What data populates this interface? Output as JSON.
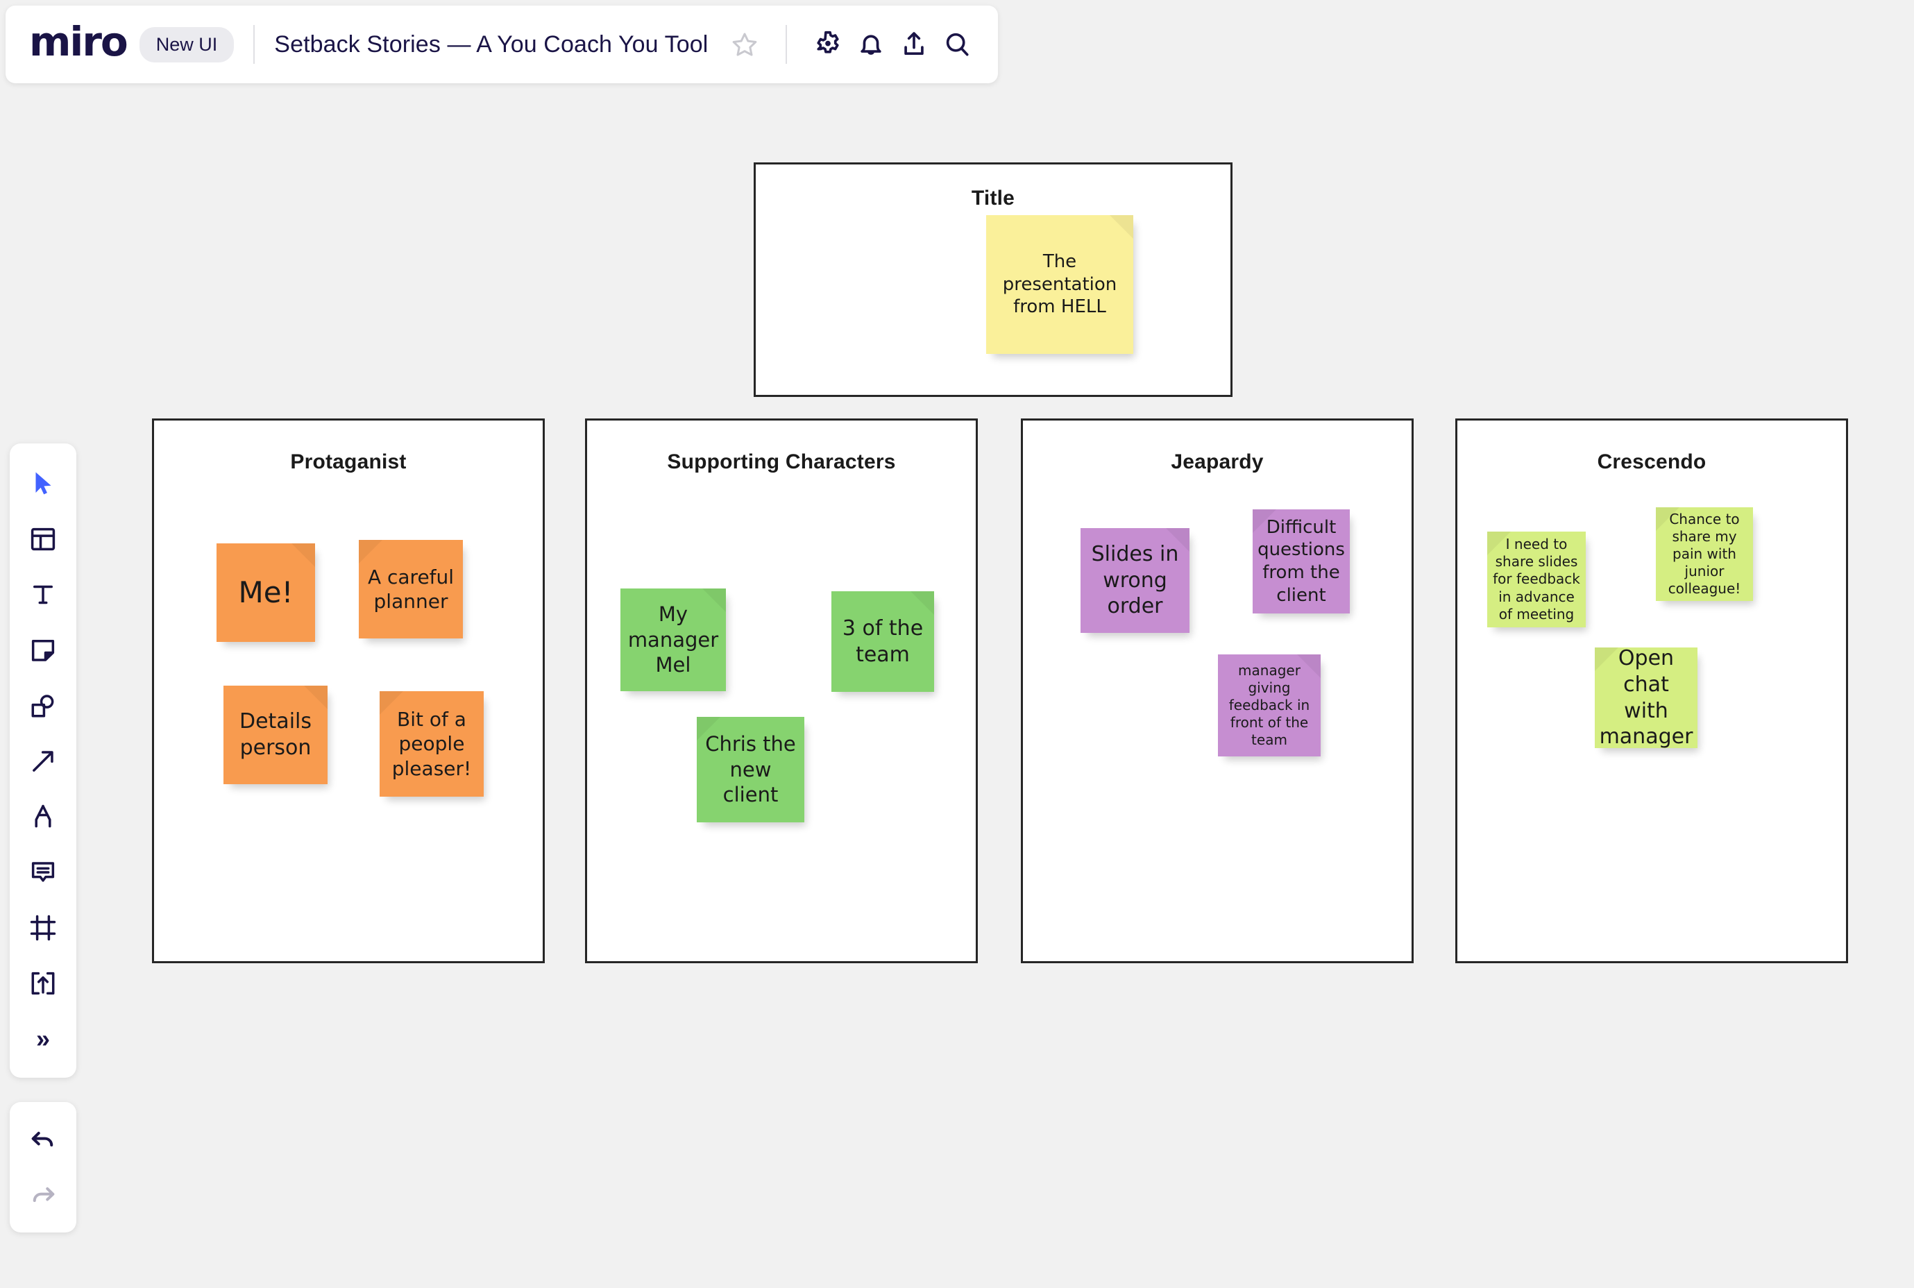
{
  "topbar": {
    "logo_text": "miro",
    "badge_label": "New UI",
    "board_title": "Setback Stories — A You Coach You Tool",
    "icons": [
      {
        "name": "star-icon",
        "label": "Favorite"
      },
      {
        "name": "gear-icon",
        "label": "Settings"
      },
      {
        "name": "bell-icon",
        "label": "Notifications"
      },
      {
        "name": "upload-icon",
        "label": "Share"
      },
      {
        "name": "search-icon",
        "label": "Search"
      }
    ]
  },
  "toolbar": {
    "tools": [
      {
        "name": "cursor-tool",
        "label": "Select",
        "active": true
      },
      {
        "name": "templates-tool",
        "label": "Templates"
      },
      {
        "name": "text-tool",
        "label": "Text"
      },
      {
        "name": "sticky-note-tool",
        "label": "Sticky note"
      },
      {
        "name": "shapes-tool",
        "label": "Shapes"
      },
      {
        "name": "connector-tool",
        "label": "Connection line"
      },
      {
        "name": "pen-tool",
        "label": "Pen"
      },
      {
        "name": "comment-tool",
        "label": "Comment"
      },
      {
        "name": "frame-tool",
        "label": "Frame"
      },
      {
        "name": "upload-tool",
        "label": "Upload"
      },
      {
        "name": "more-tools",
        "label": "More tools"
      }
    ],
    "history": [
      {
        "name": "undo-button",
        "label": "Undo",
        "enabled": true
      },
      {
        "name": "redo-button",
        "label": "Redo",
        "enabled": false
      }
    ]
  },
  "colors": {
    "sticky_yellow": "#FAF09A",
    "sticky_orange": "#F89B4F",
    "sticky_green": "#86D36F",
    "sticky_purple": "#C68ED1",
    "sticky_lime": "#D5EE82",
    "frame_border": "#262626",
    "canvas": "#F1F1F1",
    "brand": "#1A1446",
    "accent": "#4262FF"
  },
  "board": {
    "frames": [
      {
        "name": "frame-title",
        "title": "Title",
        "notes": [
          {
            "name": "sticky-note-presentation-hell",
            "text": "The presentation from HELL",
            "color": "#FAF09A",
            "font_size": 26,
            "fold": "tr"
          }
        ]
      },
      {
        "name": "frame-protaganist",
        "title": "Protaganist",
        "notes": [
          {
            "name": "sticky-note-me",
            "text": "Me!",
            "color": "#F89B4F",
            "font_size": 42,
            "fold": "tr"
          },
          {
            "name": "sticky-note-careful-planner",
            "text": "A careful planner",
            "color": "#F89B4F",
            "font_size": 28,
            "fold": "tl"
          },
          {
            "name": "sticky-note-details-person",
            "text": "Details person",
            "color": "#F89B4F",
            "font_size": 30,
            "fold": "tr"
          },
          {
            "name": "sticky-note-people-pleaser",
            "text": "Bit of a people pleaser!",
            "color": "#F89B4F",
            "font_size": 28,
            "fold": "tl"
          }
        ]
      },
      {
        "name": "frame-supporting-characters",
        "title": "Supporting Characters",
        "notes": [
          {
            "name": "sticky-note-manager-mel",
            "text": "My manager Mel",
            "color": "#86D36F",
            "font_size": 29,
            "fold": "tr"
          },
          {
            "name": "sticky-note-three-of-team",
            "text": "3 of the team",
            "color": "#86D36F",
            "font_size": 30,
            "fold": "tr"
          },
          {
            "name": "sticky-note-chris-new-client",
            "text": "Chris the new client",
            "color": "#86D36F",
            "font_size": 29,
            "fold": "tl"
          }
        ]
      },
      {
        "name": "frame-jeapardy",
        "title": "Jeapardy",
        "notes": [
          {
            "name": "sticky-note-slides-wrong-order",
            "text": "Slides in wrong order",
            "color": "#C68ED1",
            "font_size": 30,
            "fold": "tr"
          },
          {
            "name": "sticky-note-difficult-questions",
            "text": "Difficult questions from the client",
            "color": "#C68ED1",
            "font_size": 26,
            "fold": "tl"
          },
          {
            "name": "sticky-note-manager-feedback",
            "text": "manager giving feedback in front of the team",
            "color": "#C68ED1",
            "font_size": 20,
            "fold": "tr"
          }
        ]
      },
      {
        "name": "frame-crescendo",
        "title": "Crescendo",
        "notes": [
          {
            "name": "sticky-note-share-slides-feedback",
            "text": "I need to share slides for feedback in advance of meeting",
            "color": "#D5EE82",
            "font_size": 20,
            "fold": "tl"
          },
          {
            "name": "sticky-note-share-pain-junior",
            "text": "Chance to share my pain with junior colleague!",
            "color": "#D5EE82",
            "font_size": 20,
            "fold": "tl"
          },
          {
            "name": "sticky-note-open-chat-manager",
            "text": "Open chat with manager",
            "color": "#D5EE82",
            "font_size": 30,
            "fold": "tl"
          }
        ]
      }
    ]
  }
}
